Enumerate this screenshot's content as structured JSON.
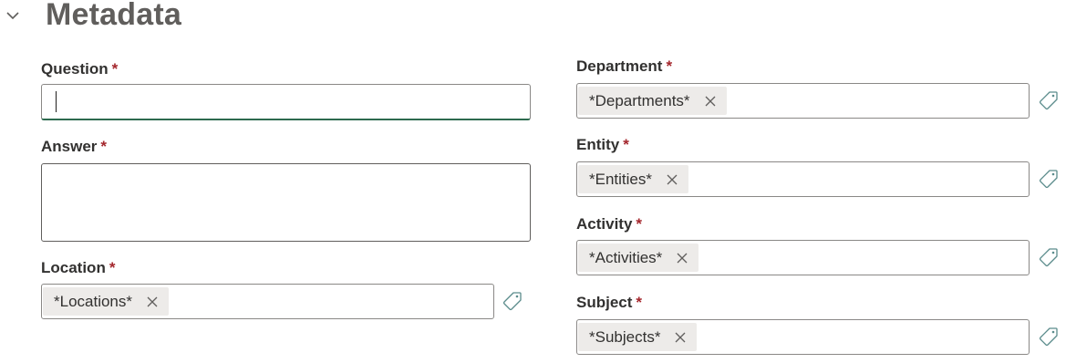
{
  "section": {
    "title": "Metadata",
    "collapse_icon": "chevron-down-icon"
  },
  "required_marker": "*",
  "fields": {
    "question": {
      "label": "Question",
      "value": ""
    },
    "answer": {
      "label": "Answer",
      "value": ""
    },
    "location": {
      "label": "Location",
      "tag": "*Locations*"
    },
    "department": {
      "label": "Department",
      "tag": "*Departments*"
    },
    "entity": {
      "label": "Entity",
      "tag": "*Entities*"
    },
    "activity": {
      "label": "Activity",
      "tag": "*Activities*"
    },
    "subject": {
      "label": "Subject",
      "tag": "*Subjects*"
    }
  },
  "icons": {
    "remove": "close-icon",
    "tag": "tag-icon"
  },
  "colors": {
    "required": "#a4262c",
    "focus_underline": "#2d6a4f",
    "chip_bg": "#edebe9",
    "tag_icon": "#5b8c8c"
  }
}
